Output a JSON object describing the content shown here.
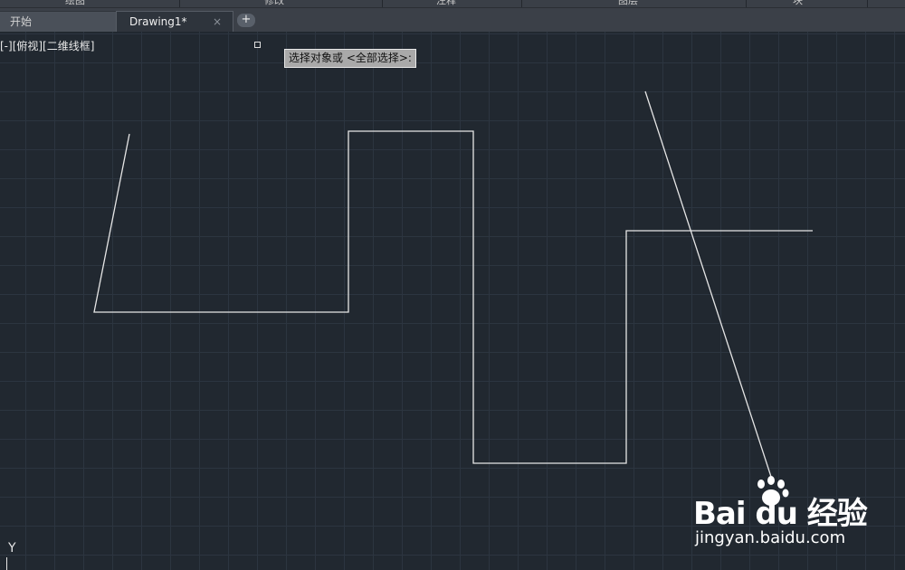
{
  "ribbon": {
    "panels": [
      "绘图",
      "修改",
      "注释",
      "图层",
      "块"
    ]
  },
  "tabs": {
    "start_label": "开始",
    "drawing_label": "Drawing1*",
    "close_glyph": "×",
    "add_glyph": "+"
  },
  "viewport": {
    "label": "[-][俯视][二维线框]"
  },
  "command": {
    "prompt": "选择对象或 <全部选择>:"
  },
  "ucs": {
    "y_label": "Y"
  },
  "watermark": {
    "logo": "Bai du 经验",
    "url": "jingyan.baidu.com"
  },
  "colors": {
    "canvas_bg": "#212830",
    "line": "#e6e6e6",
    "tooltip_bg": "#a9a9a9"
  }
}
